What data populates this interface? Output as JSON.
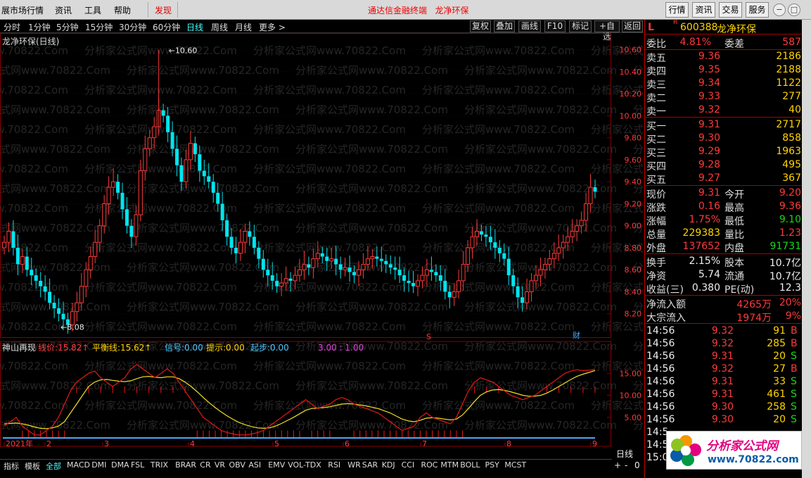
{
  "menu": {
    "items": [
      "展市场行情",
      "资讯",
      "工具",
      "帮助"
    ],
    "discover": "发现",
    "center_left": "通达信金融终端",
    "center_right": "龙净环保",
    "right_buttons": [
      "行情",
      "资讯",
      "交易",
      "服务"
    ]
  },
  "periods": {
    "items": [
      "分时",
      "1分钟",
      "5分钟",
      "15分钟",
      "30分钟",
      "60分钟",
      "日线",
      "周线",
      "月线",
      "更多 >"
    ],
    "active": "日线",
    "tools": [
      "复权",
      "叠加",
      "画线",
      "F10",
      "标记",
      "+自选",
      "返回"
    ]
  },
  "stock": {
    "title": "龙净环保(日线)",
    "code": "600388",
    "name": "龙净环保",
    "flag_l": "L",
    "flag_r": "R"
  },
  "colors": {
    "up": "#ff3a3a",
    "down": "#00e5f0",
    "ma_red": "#e81818",
    "ma_yellow": "#f0e020",
    "grid": "#8b0000"
  },
  "watermark": "分析家公式网www.70822.Com",
  "chart_data": [
    {
      "type": "candlestick",
      "title": "龙净环保(日线)",
      "ylim": [
        8.0,
        10.7
      ],
      "yticks": [
        "10.60",
        "10.40",
        "10.20",
        "10.00",
        "9.80",
        "9.60",
        "9.40",
        "9.20",
        "9.00",
        "8.80",
        "8.60",
        "8.40",
        "8.20"
      ],
      "high_label": "10.60",
      "low_label": "8.08",
      "markers": {
        "s": "S",
        "cai": "财"
      },
      "months": [
        "2021年",
        "2",
        "3",
        "4",
        "5",
        "6",
        "7",
        "8",
        "9"
      ],
      "close": [
        8.85,
        8.95,
        8.8,
        8.65,
        8.72,
        8.6,
        8.55,
        8.5,
        8.45,
        8.4,
        8.3,
        8.25,
        8.2,
        8.15,
        8.1,
        8.22,
        8.3,
        8.45,
        8.6,
        8.72,
        8.85,
        9.0,
        9.2,
        9.35,
        9.4,
        9.3,
        9.15,
        9.0,
        8.9,
        9.1,
        9.5,
        9.7,
        9.8,
        9.9,
        10.05,
        10.0,
        9.85,
        9.7,
        9.55,
        9.4,
        9.6,
        9.75,
        9.65,
        9.5,
        9.45,
        9.4,
        9.3,
        9.2,
        9.05,
        8.9,
        8.8,
        8.75,
        8.85,
        8.95,
        8.9,
        8.8,
        8.7,
        8.6,
        8.55,
        8.5,
        8.45,
        8.48,
        8.52,
        8.5,
        8.55,
        8.6,
        8.65,
        8.62,
        8.7,
        8.75,
        8.72,
        8.68,
        8.7,
        8.65,
        8.6,
        8.62,
        8.58,
        8.55,
        8.6,
        8.65,
        8.7,
        8.72,
        8.7,
        8.68,
        8.65,
        8.62,
        8.6,
        8.55,
        8.5,
        8.48,
        8.45,
        8.5,
        8.55,
        8.6,
        8.58,
        8.55,
        8.5,
        8.4,
        8.35,
        8.4,
        8.5,
        8.65,
        8.8,
        8.9,
        8.95,
        8.92,
        8.9,
        8.85,
        8.8,
        8.75,
        8.7,
        8.55,
        8.45,
        8.35,
        8.3,
        8.4,
        8.5,
        8.55,
        8.6,
        8.65,
        8.7,
        8.75,
        8.8,
        8.85,
        8.9,
        8.95,
        9.0,
        9.05,
        9.2,
        9.35,
        9.31
      ],
      "volume_note": ""
    },
    {
      "type": "line",
      "title": "神山再现",
      "indicators": [
        {
          "label": "线价:",
          "value": "15.82",
          "arrow": "↑",
          "color": "red"
        },
        {
          "label": "平衡线:",
          "value": "15.62",
          "arrow": "↑",
          "color": "yellow"
        },
        {
          "label": "信号:",
          "value": "0.00",
          "color": "cyan"
        },
        {
          "label": "提示:",
          "value": "0.00",
          "color": "yellow"
        },
        {
          "label": "起步:",
          "value": "0.00",
          "color": "cyan"
        },
        {
          "label": "",
          "value": "3.00 : 1.00",
          "color": "magenta"
        }
      ],
      "yticks": [
        "15.00",
        "10.00",
        "5.00"
      ],
      "ylim": [
        0,
        20
      ],
      "series": [
        {
          "name": "线价",
          "values": [
            3,
            4,
            5,
            3,
            2,
            1,
            1,
            2,
            3,
            5,
            8,
            11,
            13,
            14,
            15,
            15.5,
            14,
            13,
            12,
            13,
            14,
            16,
            17,
            16,
            15,
            14,
            15,
            16,
            15,
            13,
            11,
            9,
            7,
            5,
            4,
            3,
            2,
            1.5,
            1.2,
            1,
            1,
            1.2,
            1.5,
            2,
            3,
            4,
            5,
            6,
            7,
            8,
            9,
            8,
            7,
            7.5,
            8,
            9,
            9.5,
            9,
            8,
            7.5,
            7,
            6.5,
            6,
            5,
            4,
            3,
            2,
            2.5,
            3,
            5,
            6,
            5,
            4.5,
            4,
            3.5,
            5,
            8,
            11,
            13,
            14,
            13.5,
            13,
            12,
            11,
            10,
            9.5,
            9,
            9.5,
            10,
            11,
            12,
            13,
            14,
            15,
            15.5,
            15.8,
            15.6,
            15.7,
            15.82
          ]
        },
        {
          "name": "平衡线",
          "values": [
            3.5,
            3.6,
            3.7,
            3.5,
            3.2,
            2.8,
            2.5,
            2.4,
            2.6,
            3,
            4,
            6,
            8,
            10,
            12,
            13,
            13.5,
            13.6,
            13.4,
            13.2,
            13.1,
            13.3,
            13.8,
            14.2,
            14.3,
            14.1,
            14,
            14.2,
            14.2,
            13.8,
            13,
            12,
            10.8,
            9.5,
            8.3,
            7.2,
            6.2,
            5.3,
            4.5,
            3.8,
            3.3,
            2.9,
            2.6,
            2.5,
            2.6,
            3,
            3.6,
            4.3,
            5,
            5.8,
            6.6,
            7,
            7.1,
            7.2,
            7.4,
            7.7,
            8,
            8.1,
            8,
            7.8,
            7.6,
            7.3,
            7,
            6.5,
            6,
            5.3,
            4.6,
            4.2,
            4,
            4.3,
            4.8,
            4.9,
            4.8,
            4.6,
            4.4,
            4.6,
            5.5,
            7,
            8.6,
            10,
            10.8,
            11.2,
            11.3,
            11.1,
            10.8,
            10.4,
            10,
            9.8,
            9.8,
            10,
            10.5,
            11.2,
            12,
            12.8,
            13.6,
            14.3,
            14.8,
            15.2,
            15.62
          ]
        }
      ]
    }
  ],
  "quote": {
    "weibi_label": "委比",
    "weibi": "4.81%",
    "weicha_label": "委差",
    "weicha": "587",
    "sell": [
      {
        "label": "卖五",
        "price": "9.36",
        "vol": "2186"
      },
      {
        "label": "卖四",
        "price": "9.35",
        "vol": "2188"
      },
      {
        "label": "卖三",
        "price": "9.34",
        "vol": "1122"
      },
      {
        "label": "卖二",
        "price": "9.33",
        "vol": "277"
      },
      {
        "label": "卖一",
        "price": "9.32",
        "vol": "40"
      }
    ],
    "buy": [
      {
        "label": "买一",
        "price": "9.31",
        "vol": "2717"
      },
      {
        "label": "买二",
        "price": "9.30",
        "vol": "858"
      },
      {
        "label": "买三",
        "price": "9.29",
        "vol": "1963"
      },
      {
        "label": "买四",
        "price": "9.28",
        "vol": "495"
      },
      {
        "label": "买五",
        "price": "9.27",
        "vol": "367"
      }
    ],
    "stats": [
      {
        "l1": "现价",
        "v1": "9.31",
        "c1": "red",
        "l2": "今开",
        "v2": "9.20",
        "c2": "red"
      },
      {
        "l1": "涨跌",
        "v1": "0.16",
        "c1": "red",
        "l2": "最高",
        "v2": "9.36",
        "c2": "red"
      },
      {
        "l1": "涨幅",
        "v1": "1.75%",
        "c1": "red",
        "l2": "最低",
        "v2": "9.10",
        "c2": "green"
      },
      {
        "l1": "总量",
        "v1": "229383",
        "c1": "yellow",
        "l2": "量比",
        "v2": "1.23",
        "c2": "red"
      },
      {
        "l1": "外盘",
        "v1": "137652",
        "c1": "red",
        "l2": "内盘",
        "v2": "91731",
        "c2": "green"
      }
    ],
    "stats2": [
      {
        "l1": "换手",
        "v1": "2.15%",
        "c1": "white",
        "l2": "股本",
        "v2": "10.7亿",
        "c2": "white"
      },
      {
        "l1": "净资",
        "v1": "5.74",
        "c1": "white",
        "l2": "流通",
        "v2": "10.7亿",
        "c2": "white"
      },
      {
        "l1": "收益(三)",
        "v1": "0.380",
        "c1": "white",
        "l2": "PE(动)",
        "v2": "12.3",
        "c2": "white"
      }
    ],
    "flow": [
      {
        "label": "净流入额",
        "value": "4265万",
        "pct": "20%"
      },
      {
        "label": "大宗流入",
        "value": "1974万",
        "pct": "9%"
      }
    ],
    "ticks": [
      {
        "t": "14:56",
        "p": "9.32",
        "v": "91",
        "bs": "B"
      },
      {
        "t": "14:56",
        "p": "9.32",
        "v": "285",
        "bs": "B"
      },
      {
        "t": "14:56",
        "p": "9.31",
        "v": "20",
        "bs": "S"
      },
      {
        "t": "14:56",
        "p": "9.32",
        "v": "27",
        "bs": "B"
      },
      {
        "t": "14:56",
        "p": "9.31",
        "v": "33",
        "bs": "S"
      },
      {
        "t": "14:56",
        "p": "9.31",
        "v": "461",
        "bs": "S"
      },
      {
        "t": "14:56",
        "p": "9.30",
        "v": "258",
        "bs": "S"
      },
      {
        "t": "14:56",
        "p": "9.30",
        "v": "20",
        "bs": "S"
      },
      {
        "t": "14:5",
        "p": "",
        "v": "",
        "bs": ""
      },
      {
        "t": "14:5",
        "p": "",
        "v": "",
        "bs": ""
      },
      {
        "t": "15:0",
        "p": "",
        "v": "",
        "bs": ""
      }
    ]
  },
  "bottom_tabs": [
    "指标",
    "模板",
    "全部",
    "MACD",
    "DMI",
    "DMA",
    "FSL",
    "TRIX",
    "BRAR",
    "CR",
    "VR",
    "OBV",
    "ASI",
    "EMV",
    "VOL-TDX",
    "RSI",
    "WR",
    "SAR",
    "KDJ",
    "CCI",
    "ROC",
    "MTM",
    "BOLL",
    "PSY",
    "MCST"
  ],
  "bottom_right": {
    "label": "日线",
    "plus": "+",
    "minus": "-",
    "zero": "0"
  },
  "logo": {
    "line1": "分析家公式网",
    "line2": "www.70822.com"
  }
}
